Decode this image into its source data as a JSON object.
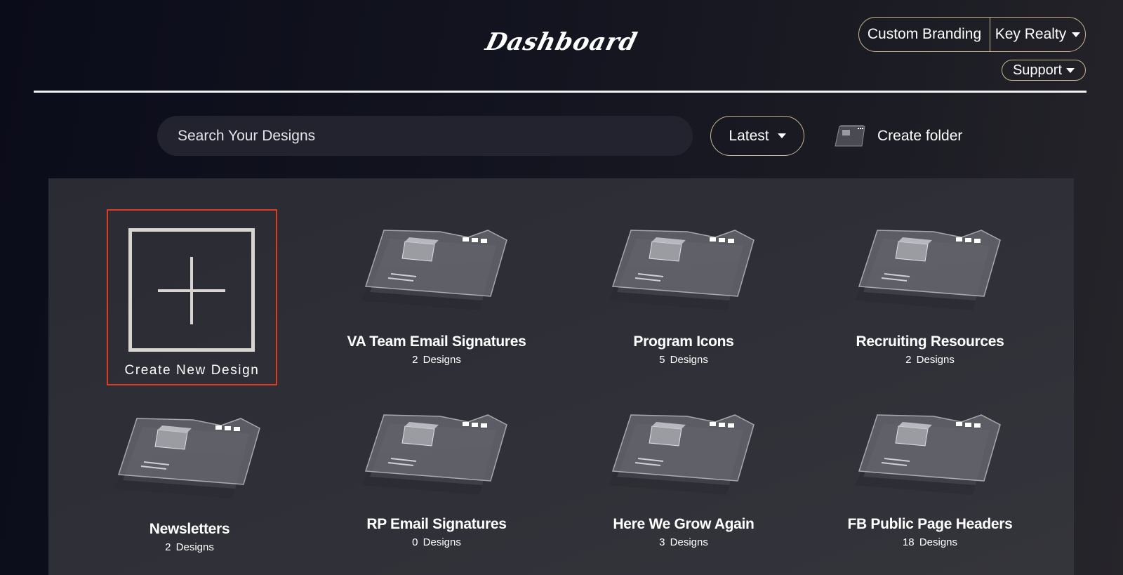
{
  "header": {
    "title": "Dashboard",
    "custom_branding": "Custom Branding",
    "account_name": "Key Realty",
    "support": "Support"
  },
  "toolbar": {
    "search_placeholder": "Search Your Designs",
    "sort_label": "Latest",
    "create_folder_label": "Create folder"
  },
  "create_new": {
    "label": "Create New Design"
  },
  "folders": [
    {
      "name": "VA Team Email Signatures",
      "count": "2 Designs"
    },
    {
      "name": "Program Icons",
      "count": "5 Designs"
    },
    {
      "name": "Recruiting Resources",
      "count": "2 Designs"
    },
    {
      "name": "Newsletters",
      "count": "2 Designs"
    },
    {
      "name": "RP Email Signatures",
      "count": "0 Designs"
    },
    {
      "name": "Here We Grow Again",
      "count": "3 Designs"
    },
    {
      "name": "FB Public Page Headers",
      "count": "18 Designs"
    }
  ],
  "colors": {
    "accent_border": "#c8b98f",
    "selection": "#e03a24",
    "panel": "#2f2f37"
  },
  "icons": {
    "folder": "folder-icon",
    "create_folder": "create-folder-icon",
    "plus": "plus-icon",
    "caret": "caret-down-icon"
  }
}
